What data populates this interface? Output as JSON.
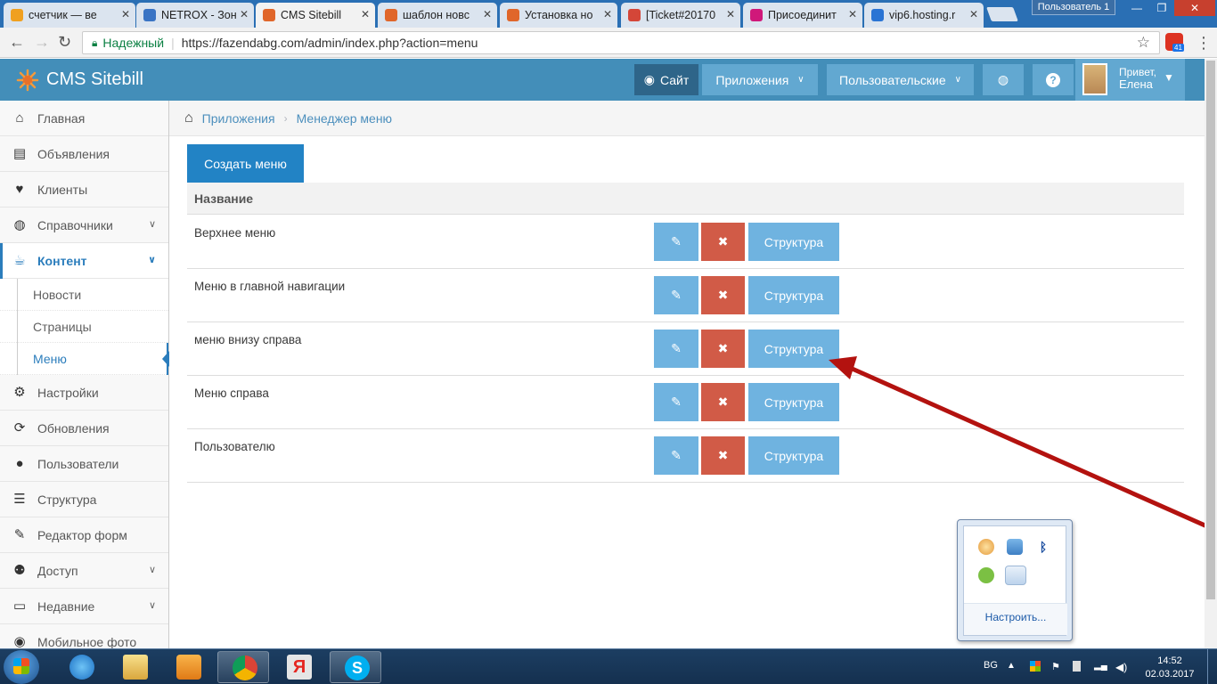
{
  "browser": {
    "tabs": [
      {
        "title": "счетчик — ве",
        "favicon_color": "#f0a020",
        "active": false
      },
      {
        "title": "NETROX - Зон",
        "favicon_color": "#3a74c4",
        "active": false
      },
      {
        "title": "CMS Sitebill",
        "favicon_color": "#e0662a",
        "active": true
      },
      {
        "title": "шаблон новс",
        "favicon_color": "#e0662a",
        "active": false
      },
      {
        "title": "Установка но",
        "favicon_color": "#e0662a",
        "active": false
      },
      {
        "title": "[Ticket#20170",
        "favicon_color": "#d44638",
        "active": false
      },
      {
        "title": "Присоединит",
        "favicon_color": "#d0187a",
        "active": false
      },
      {
        "title": "vip6.hosting.r",
        "favicon_color": "#2a74d4",
        "active": false
      }
    ],
    "user_badge": "Пользователь 1",
    "secure_label": "Надежный",
    "url": "https://fazendabg.com/admin/index.php?action=menu",
    "extension_count": "41"
  },
  "navbar": {
    "brand": "CMS Sitebill",
    "site_label": "Сайт",
    "apps_label": "Приложения",
    "custom_label": "Пользовательские",
    "greeting": "Привет,",
    "user_name": "Елена"
  },
  "sidebar": {
    "items": [
      {
        "label": "Главная",
        "icon": "home-icon"
      },
      {
        "label": "Объявления",
        "icon": "book-icon"
      },
      {
        "label": "Клиенты",
        "icon": "heart-icon"
      },
      {
        "label": "Справочники",
        "icon": "globe-icon",
        "has_chevron": true
      },
      {
        "label": "Контент",
        "icon": "coffee-icon",
        "active": true,
        "expanded": true
      }
    ],
    "sub_items": [
      {
        "label": "Новости"
      },
      {
        "label": "Страницы"
      },
      {
        "label": "Меню",
        "active": true
      }
    ],
    "items_after": [
      {
        "label": "Настройки",
        "icon": "gear-icon"
      },
      {
        "label": "Обновления",
        "icon": "refresh-icon"
      },
      {
        "label": "Пользователи",
        "icon": "user-icon"
      },
      {
        "label": "Структура",
        "icon": "list-icon"
      },
      {
        "label": "Редактор форм",
        "icon": "edit-icon"
      },
      {
        "label": "Доступ",
        "icon": "group-icon",
        "has_chevron": true
      },
      {
        "label": "Недавние",
        "icon": "desktop-icon",
        "has_chevron": true
      },
      {
        "label": "Мобильное фото",
        "icon": "camera-icon"
      }
    ]
  },
  "breadcrumb": {
    "items": [
      "Приложения",
      "Менеджер меню"
    ]
  },
  "content": {
    "create_label": "Создать меню",
    "column_header": "Название",
    "structure_label": "Структура",
    "rows": [
      {
        "name": "Верхнее меню"
      },
      {
        "name": "Меню в главной навигации"
      },
      {
        "name": "меню внизу справа"
      },
      {
        "name": "Меню справа"
      },
      {
        "name": "Пользователю"
      }
    ]
  },
  "tray_popup": {
    "configure_label": "Настроить..."
  },
  "taskbar": {
    "language": "BG",
    "time": "14:52",
    "date": "02.03.2017"
  },
  "colors": {
    "navbar": "#438eb9",
    "accent": "#2283c5",
    "edit_button": "#6fb3e0",
    "delete_button": "#d15b47",
    "annotation_arrow": "#b3120f"
  }
}
